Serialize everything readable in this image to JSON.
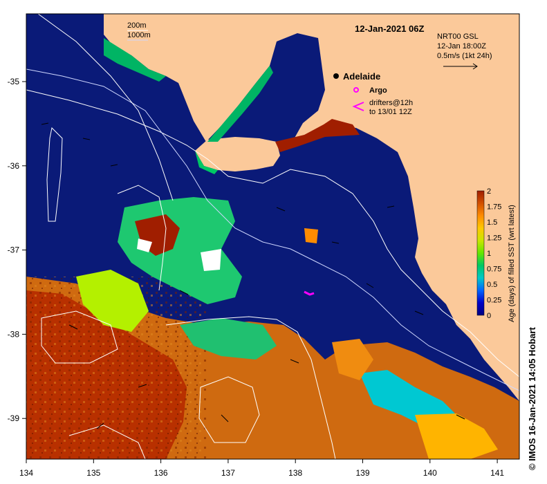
{
  "map": {
    "title": "12-Jan-2021 06Z",
    "credit": "© IMOS 16-Jan-2021 14:05 Hobart",
    "contour_legend": [
      "200m",
      "1000m"
    ],
    "place_label": "Adelaide",
    "argo_label": "Argo",
    "drifters_label_1": "drifters@12h",
    "drifters_label_2": "to 13/01 12Z",
    "current_legend": [
      "NRT00 GSL",
      "12-Jan 18:00Z",
      "0.5m/s (1kt 24h)"
    ],
    "x_ticks": [
      "134",
      "135",
      "136",
      "137",
      "138",
      "139",
      "140",
      "141"
    ],
    "y_ticks": [
      "-35",
      "-36",
      "-37",
      "-38",
      "-39"
    ],
    "colorbar": {
      "label": "Age (days) of filled SST (wrt latest)",
      "ticks": [
        "2",
        "1.75",
        "1.5",
        "1.25",
        "1",
        "0.75",
        "0.5",
        "0.25",
        "0"
      ],
      "colors": [
        "#000080",
        "#0000c8",
        "#0064ff",
        "#00c8c8",
        "#00c864",
        "#64e600",
        "#c8e600",
        "#ffc800",
        "#ff8c00",
        "#d25000",
        "#a01e00"
      ]
    },
    "colors": {
      "ocean": "#0a1a78",
      "land": "#fbc99a",
      "argo": "#ff00ff",
      "drifter": "#ff00ff"
    }
  }
}
